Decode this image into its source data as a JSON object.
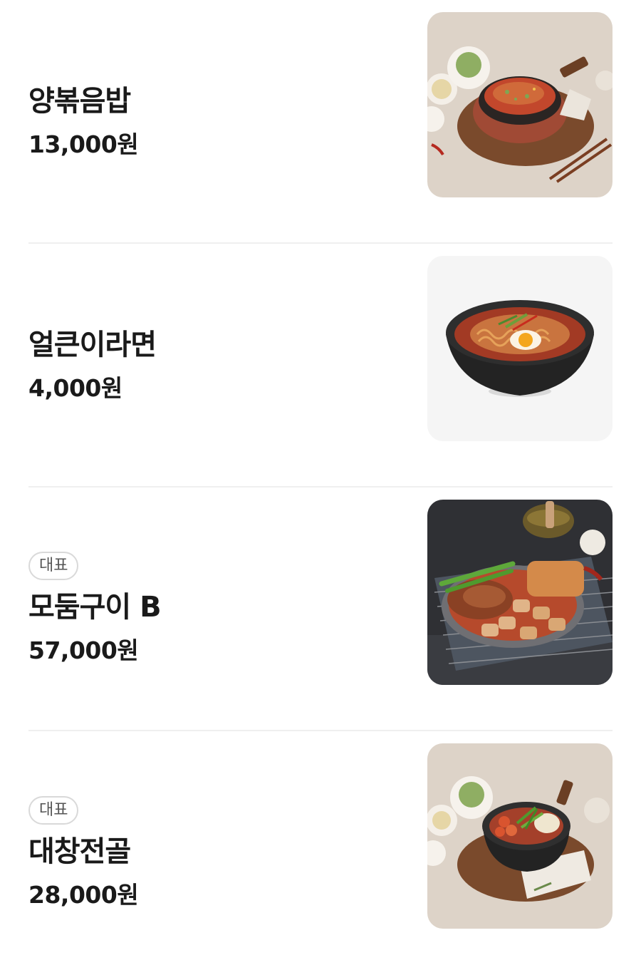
{
  "menu": {
    "items": [
      {
        "name": "양볶음밥",
        "price": "13,000원",
        "badge": "",
        "image": "fried-rice-hotplate-photo"
      },
      {
        "name": "얼큰이라면",
        "price": "4,000원",
        "badge": "",
        "image": "spicy-ramen-bowl-photo"
      },
      {
        "name": "모둠구이 B",
        "price": "57,000원",
        "badge": "대표",
        "image": "mixed-grill-platter-photo"
      },
      {
        "name": "대창전골",
        "price": "28,000원",
        "badge": "대표",
        "image": "daechang-hotpot-photo"
      }
    ]
  },
  "colors": {
    "text": "#1a1a1a",
    "divider": "#efefef",
    "badge_border": "#d9d9d9",
    "badge_text": "#555555"
  }
}
